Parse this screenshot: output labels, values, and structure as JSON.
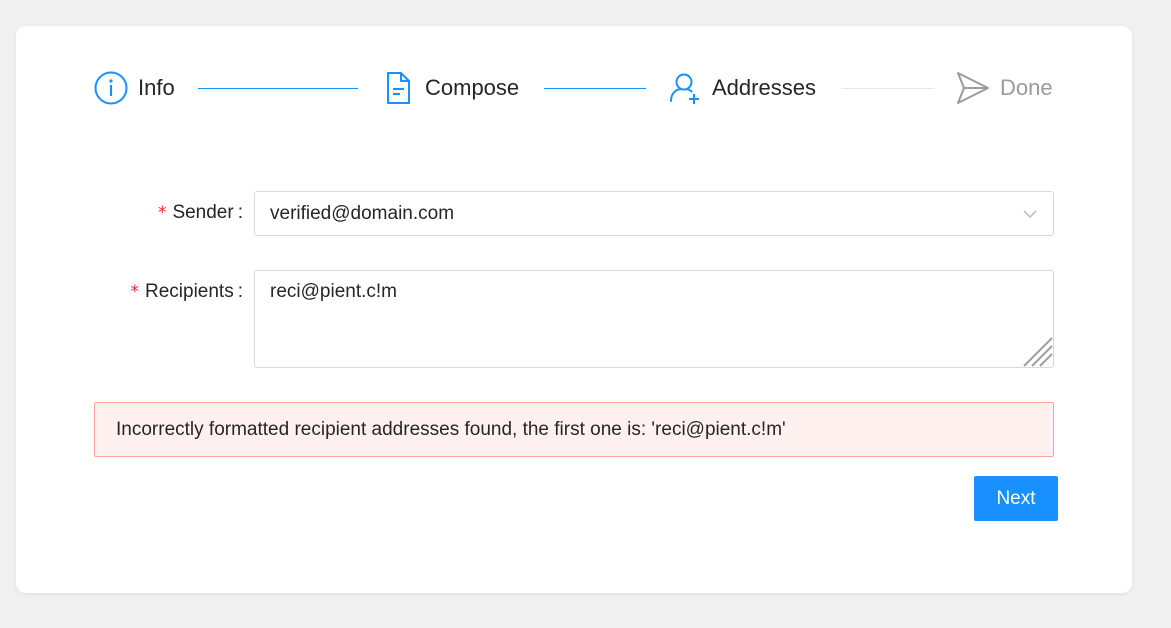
{
  "steps": [
    {
      "label": "Info",
      "icon": "info-circle-icon",
      "status": "done"
    },
    {
      "label": "Compose",
      "icon": "file-text-icon",
      "status": "done"
    },
    {
      "label": "Addresses",
      "icon": "user-add-icon",
      "status": "current"
    },
    {
      "label": "Done",
      "icon": "send-icon",
      "status": "pending"
    }
  ],
  "form": {
    "sender": {
      "required_mark": "*",
      "label": "Sender",
      "colon": ":",
      "value": "verified@domain.com"
    },
    "recipients": {
      "required_mark": "*",
      "label": "Recipients",
      "colon": ":",
      "value": "reci@pient.c!m"
    }
  },
  "alert": {
    "message": "Incorrectly formatted recipient addresses found, the first one is: 'reci@pient.c!m'"
  },
  "actions": {
    "next_label": "Next"
  },
  "colors": {
    "primary": "#1890ff",
    "error": "#f5222d",
    "alert_bg": "#fff1f0",
    "alert_border": "#ffa39e",
    "pending": "#9b9b9b"
  }
}
